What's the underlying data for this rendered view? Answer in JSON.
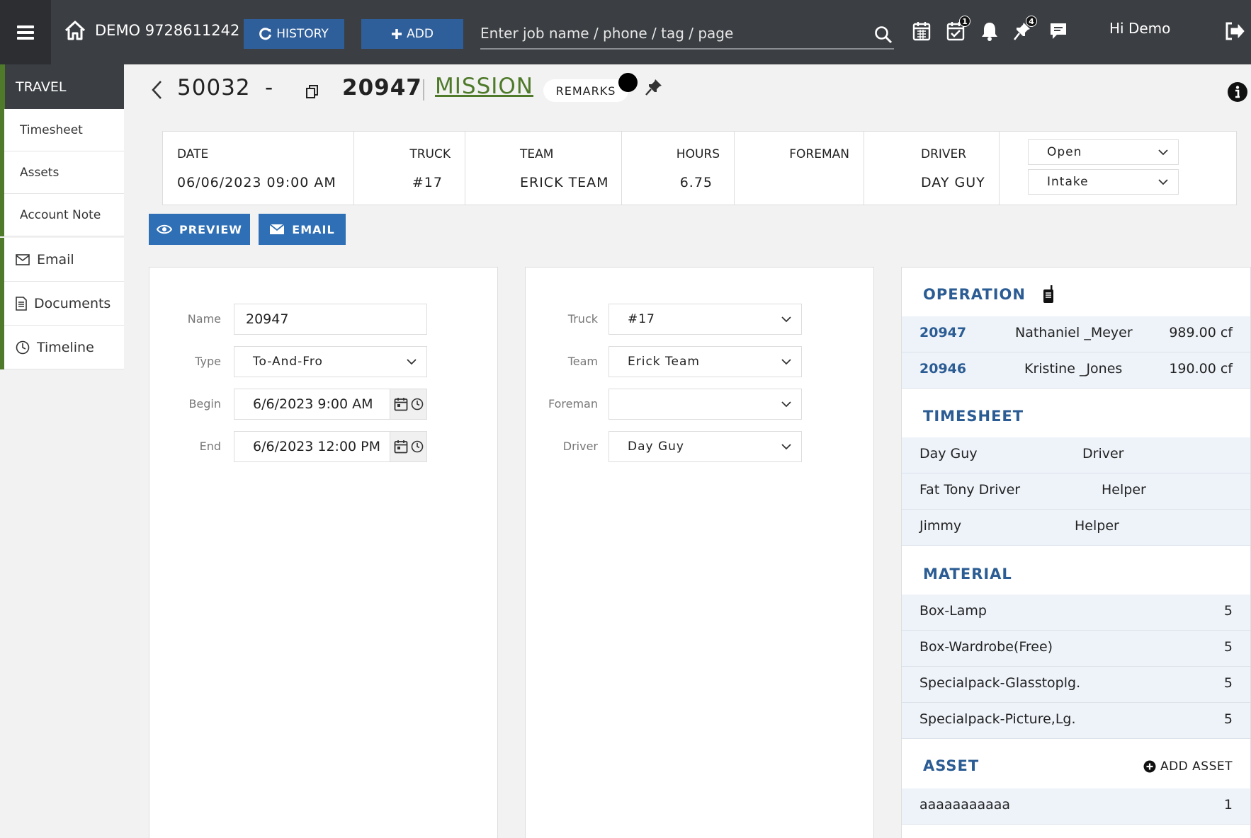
{
  "topbar": {
    "company": "DEMO 9728611242",
    "history_label": "HISTORY",
    "add_label": "ADD",
    "search_placeholder": "Enter job name / phone / tag / page",
    "tasks_badge": "1",
    "pins_badge": "4",
    "greeting": "Hi Demo"
  },
  "sidebar": {
    "header": "TRAVEL",
    "subitems": [
      "Timesheet",
      "Assets",
      "Account Note"
    ],
    "items": [
      {
        "label": "Email",
        "icon": "envelope-icon"
      },
      {
        "label": "Documents",
        "icon": "document-icon"
      },
      {
        "label": "Timeline",
        "icon": "clock-icon"
      }
    ]
  },
  "header": {
    "job_id": "50032",
    "dash": "-",
    "job_number": "20947",
    "mission": "MISSION",
    "remarks": "REMARKS"
  },
  "summary": {
    "date_label": "DATE",
    "date_value": "06/06/2023 09:00 AM",
    "truck_label": "TRUCK",
    "truck_value": "#17",
    "team_label": "TEAM",
    "team_value": "ERICK TEAM",
    "hours_label": "HOURS",
    "hours_value": "6.75",
    "foreman_label": "FOREMAN",
    "foreman_value": "",
    "driver_label": "DRIVER",
    "driver_value": "DAY GUY",
    "status": "Open",
    "stage": "Intake"
  },
  "actions": {
    "preview": "PREVIEW",
    "email": "EMAIL"
  },
  "form_left": {
    "name_label": "Name",
    "name_value": "20947",
    "type_label": "Type",
    "type_value": "To-And-Fro",
    "begin_label": "Begin",
    "begin_value": "6/6/2023 9:00 AM",
    "end_label": "End",
    "end_value": "6/6/2023 12:00 PM"
  },
  "form_mid": {
    "truck_label": "Truck",
    "truck_value": "#17",
    "team_label": "Team",
    "team_value": "Erick Team",
    "foreman_label": "Foreman",
    "foreman_value": "",
    "driver_label": "Driver",
    "driver_value": "Day Guy"
  },
  "operation": {
    "title": "OPERATION",
    "rows": [
      {
        "job": "20947",
        "name": "Nathaniel _Meyer",
        "volume": "989.00 cf"
      },
      {
        "job": "20946",
        "name": "Kristine _Jones",
        "volume": "190.00 cf"
      }
    ]
  },
  "timesheet": {
    "title": "TIMESHEET",
    "rows": [
      {
        "name": "Day Guy",
        "role": "Driver"
      },
      {
        "name": "Fat Tony Driver",
        "role": "Helper"
      },
      {
        "name": "Jimmy",
        "role": "Helper"
      }
    ]
  },
  "material": {
    "title": "MATERIAL",
    "rows": [
      {
        "item": "Box-Lamp",
        "qty": "5"
      },
      {
        "item": "Box-Wardrobe(Free)",
        "qty": "5"
      },
      {
        "item": "Specialpack-Glasstoplg.",
        "qty": "5"
      },
      {
        "item": "Specialpack-Picture,Lg.",
        "qty": "5"
      }
    ]
  },
  "asset": {
    "title": "ASSET",
    "add_label": "ADD ASSET",
    "rows": [
      {
        "item": "aaaaaaaaaaa",
        "qty": "1"
      }
    ]
  },
  "colors": {
    "topbar": "#3b3e42",
    "accent_green": "#4e7a2a",
    "button_blue": "#2f6fb5",
    "section_blue": "#2b5c93"
  }
}
